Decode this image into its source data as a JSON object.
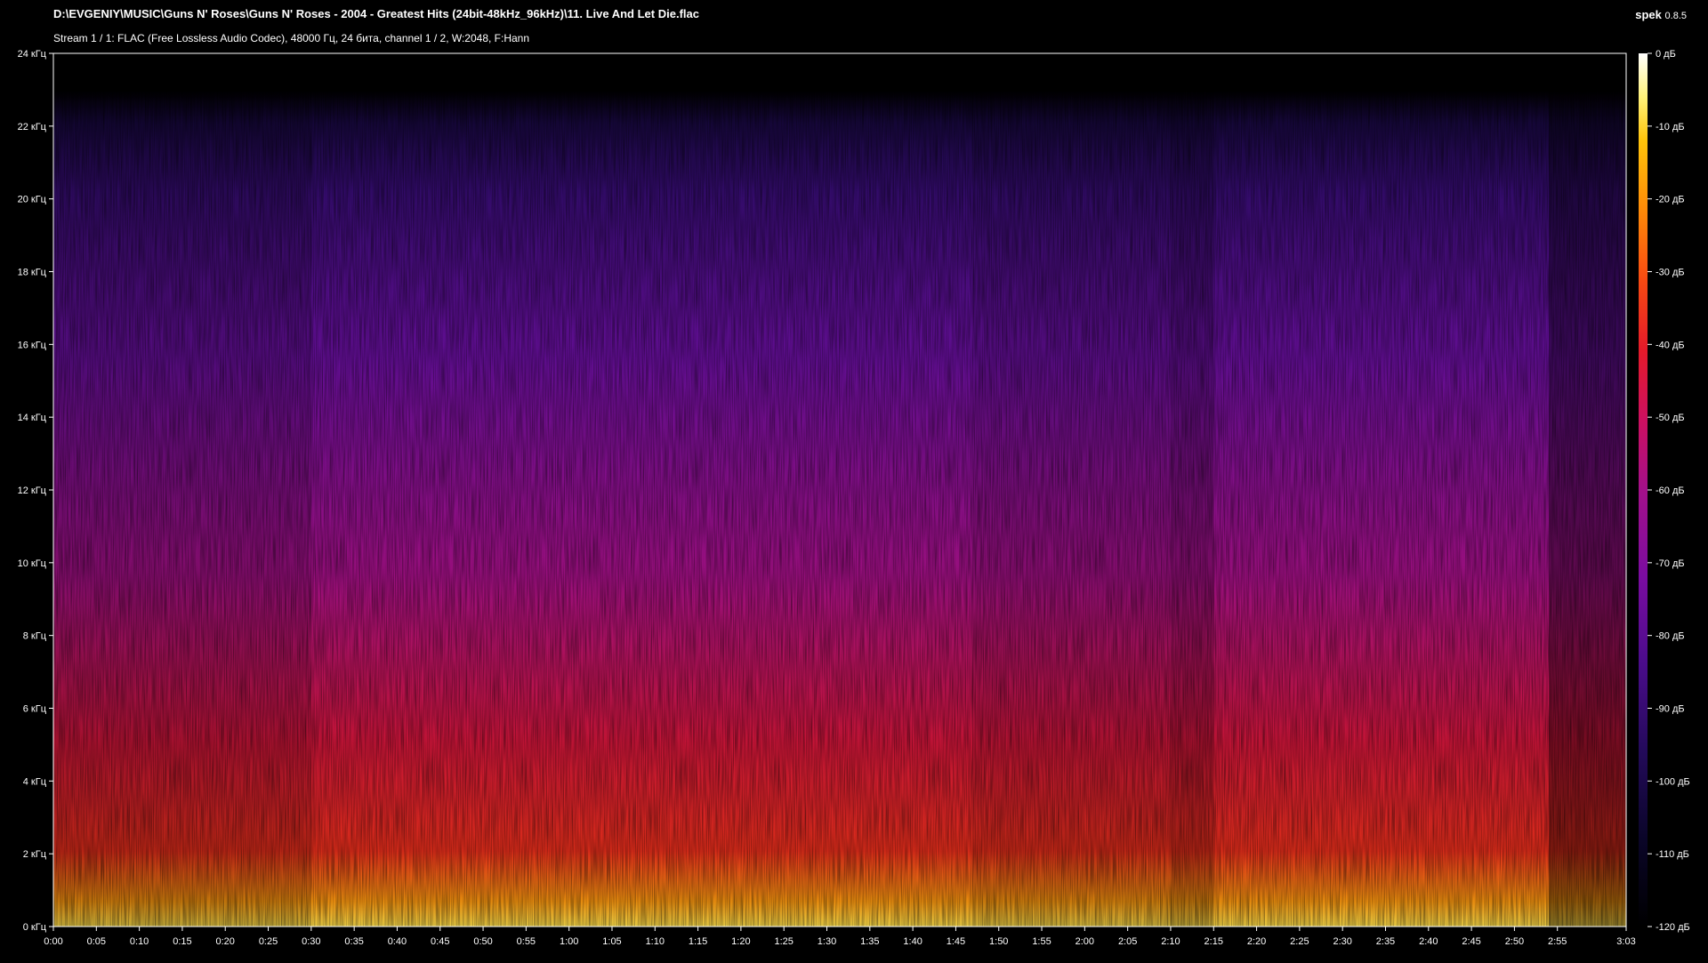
{
  "window": {
    "file_path": "D:\\EVGENIY\\MUSIC\\Guns N' Roses\\Guns N' Roses - 2004 - Greatest Hits (24bit-48kHz_96kHz)\\11. Live And Let Die.flac",
    "stream_info": "Stream 1 / 1: FLAC (Free Lossless Audio Codec), 48000 Гц, 24 бита, channel 1 / 2, W:2048, F:Hann",
    "app_name": "spek",
    "app_version": "0.8.5"
  },
  "colors": {
    "background": "#000000",
    "axis": "#ffffff",
    "palette": [
      "#000000",
      "#0a0528",
      "#230a5a",
      "#4a0c8a",
      "#7a0ca0",
      "#a4108a",
      "#cc1060",
      "#e41a2a",
      "#f84a12",
      "#fe8a08",
      "#ffc40a",
      "#fff27a",
      "#ffffff"
    ]
  },
  "chart_data": {
    "type": "heatmap",
    "title": "",
    "xlabel": "",
    "ylabel": "",
    "x_unit": "min:sec",
    "xlim": [
      "0:00",
      "3:03"
    ],
    "x_ticks": [
      "0:00",
      "0:05",
      "0:10",
      "0:15",
      "0:20",
      "0:25",
      "0:30",
      "0:35",
      "0:40",
      "0:45",
      "0:50",
      "0:55",
      "1:00",
      "1:05",
      "1:10",
      "1:15",
      "1:20",
      "1:25",
      "1:30",
      "1:35",
      "1:40",
      "1:45",
      "1:50",
      "1:55",
      "2:00",
      "2:05",
      "2:10",
      "2:15",
      "2:20",
      "2:25",
      "2:30",
      "2:35",
      "2:40",
      "2:45",
      "2:50",
      "2:55",
      "3:03"
    ],
    "y_unit": "kHz",
    "ylim": [
      0,
      24
    ],
    "y_ticks": [
      "0 кГц",
      "2 кГц",
      "4 кГц",
      "6 кГц",
      "8 кГц",
      "10 кГц",
      "12 кГц",
      "14 кГц",
      "16 кГц",
      "18 кГц",
      "20 кГц",
      "22 кГц",
      "24 кГц"
    ],
    "y_tick_values": [
      0,
      2,
      4,
      6,
      8,
      10,
      12,
      14,
      16,
      18,
      20,
      22,
      24
    ],
    "colorbar": {
      "unit": "dB",
      "range": [
        -120,
        0
      ],
      "ticks": [
        "0 дБ",
        "-10 дБ",
        "-20 дБ",
        "-30 дБ",
        "-40 дБ",
        "-50 дБ",
        "-60 дБ",
        "-70 дБ",
        "-80 дБ",
        "-90 дБ",
        "-100 дБ",
        "-110 дБ",
        "-120 дБ"
      ]
    },
    "approx_cutoff_khz": 23,
    "approx_energy_profile": [
      {
        "from": "0:00",
        "to": "0:29",
        "level_db_low_freq": -35,
        "level_db_high_freq": -95
      },
      {
        "from": "0:30",
        "to": "1:46",
        "level_db_low_freq": -15,
        "level_db_high_freq": -75
      },
      {
        "from": "1:47",
        "to": "2:09",
        "level_db_low_freq": -30,
        "level_db_high_freq": -100
      },
      {
        "from": "2:10",
        "to": "2:14",
        "level_db_low_freq": -45,
        "level_db_high_freq": -110
      },
      {
        "from": "2:15",
        "to": "2:53",
        "level_db_low_freq": -15,
        "level_db_high_freq": -75
      },
      {
        "from": "2:54",
        "to": "3:03",
        "level_db_low_freq": -70,
        "level_db_high_freq": -115
      }
    ]
  }
}
